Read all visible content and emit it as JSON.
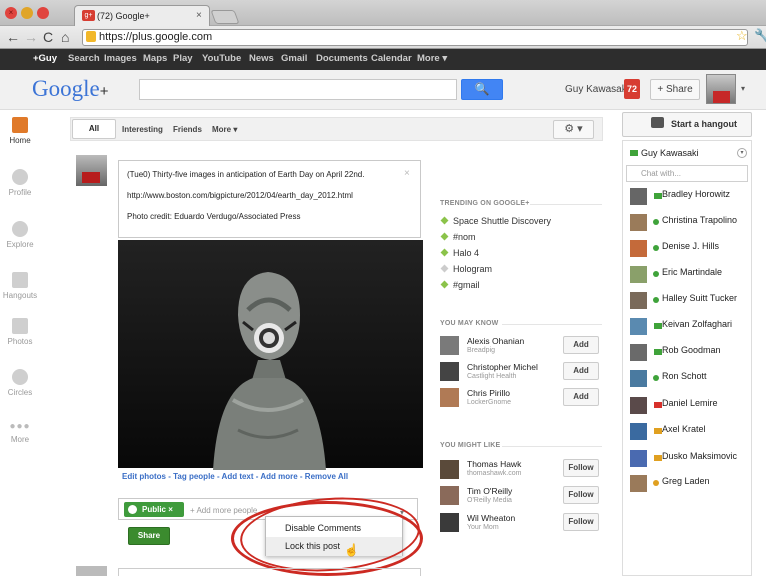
{
  "browser": {
    "tab_title": "(72) Google+",
    "tab_favicon": "g+",
    "url": "https://plus.google.com",
    "icons": [
      "back-icon",
      "forward-icon",
      "reload-icon",
      "home-icon",
      "lock-icon",
      "star-icon",
      "wrench-icon"
    ]
  },
  "gbar": {
    "items": [
      "+Guy",
      "Search",
      "Images",
      "Maps",
      "Play",
      "YouTube",
      "News",
      "Gmail",
      "Documents",
      "Calendar",
      "More ▾"
    ]
  },
  "header": {
    "logo_text": "Google",
    "logo_plus": "+",
    "search_button": "🔍",
    "user_name": "Guy Kawasaki",
    "notifications": "72",
    "share_button": "+ Share",
    "avatar_caret": "▾"
  },
  "left_nav": [
    {
      "label": "Home",
      "icon": "home-icon"
    },
    {
      "label": "Profile",
      "icon": "profile-icon"
    },
    {
      "label": "Explore",
      "icon": "explore-icon"
    },
    {
      "label": "Hangouts",
      "icon": "hangouts-icon"
    },
    {
      "label": "Photos",
      "icon": "photos-icon"
    },
    {
      "label": "Circles",
      "icon": "circles-icon"
    },
    {
      "label": "More",
      "icon": "more-icon"
    }
  ],
  "stream_tabs": {
    "all": "All",
    "interesting": "Interesting",
    "friends": "Friends",
    "more": "More ▾",
    "gear": "⚙ ▾"
  },
  "post": {
    "line1": "(Tue0) Thirty-five images in anticipation of Earth Day on April 22nd.",
    "line2": "http://www.boston.com/bigpicture/2012/04/earth_day_2012.html",
    "line3": "Photo credit: Eduardo Verdugo/Associated Press",
    "close": "×",
    "edit_links": "Edit photos - Tag people - Add text - Add more - Remove All",
    "public_chip": "Public ×",
    "add_people": "+ Add more people",
    "share_submit": "Share",
    "menu_caret": "▾",
    "menu": [
      "Disable Comments",
      "Lock this post"
    ],
    "annotation_color": "#cc2a22"
  },
  "trending": {
    "heading": "TRENDING ON GOOGLE+",
    "items": [
      "Space Shuttle Discovery",
      "#nom",
      "Halo 4",
      "Hologram",
      "#gmail"
    ]
  },
  "may_know": {
    "heading": "YOU MAY KNOW",
    "people": [
      {
        "name": "Alexis Ohanian",
        "sub": "Breadpig",
        "button": "Add"
      },
      {
        "name": "Christopher Michel",
        "sub": "Castlight Health",
        "button": "Add"
      },
      {
        "name": "Chris Pirillo",
        "sub": "LockerGnome",
        "button": "Add"
      }
    ]
  },
  "might_like": {
    "heading": "YOU MIGHT LIKE",
    "people": [
      {
        "name": "Thomas Hawk",
        "sub": "thomashawk.com",
        "button": "Follow"
      },
      {
        "name": "Tim O'Reilly",
        "sub": "O'Reilly Media",
        "button": "Follow"
      },
      {
        "name": "Wil Wheaton",
        "sub": "Your Mom",
        "button": "Follow"
      }
    ]
  },
  "chat": {
    "hangout_button": "Start a hangout",
    "me": "Guy Kawasaki",
    "chat_with_placeholder": "Chat with...",
    "contacts": [
      {
        "name": "Bradley Horowitz",
        "status": "video-green"
      },
      {
        "name": "Christina Trapolino",
        "status": "green"
      },
      {
        "name": "Denise J. Hills",
        "status": "green"
      },
      {
        "name": "Eric Martindale",
        "status": "green"
      },
      {
        "name": "Halley Suitt Tucker",
        "status": "green"
      },
      {
        "name": "Keivan Zolfaghari",
        "status": "video-green"
      },
      {
        "name": "Rob Goodman",
        "status": "video-green"
      },
      {
        "name": "Ron Schott",
        "status": "green"
      },
      {
        "name": "Daniel Lemire",
        "status": "video-red"
      },
      {
        "name": "Axel Kratel",
        "status": "video-orange"
      },
      {
        "name": "Dusko Maksimovic",
        "status": "video-orange"
      },
      {
        "name": "Greg Laden",
        "status": "orange"
      }
    ]
  }
}
